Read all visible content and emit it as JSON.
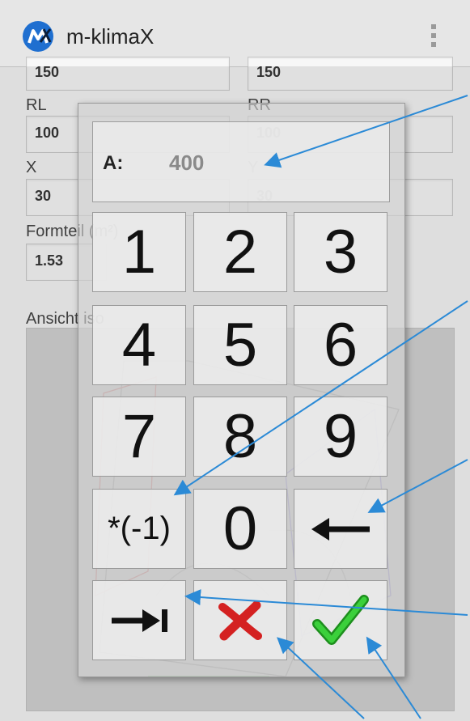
{
  "app": {
    "title": "m-klimaX"
  },
  "form": {
    "top_left_value": "150",
    "top_right_value": "150",
    "rl_label": "RL",
    "rl_value": "100",
    "rr_label": "RR",
    "rr_value": "100",
    "x_label": "X",
    "x_value": "30",
    "y_label": "Y",
    "y_value": "30",
    "formteil_label": "Formteil (m²)",
    "formteil_value": "1.53",
    "view_label": "Ansicht iso"
  },
  "keypad": {
    "display_label": "A:",
    "display_value": "400",
    "keys": [
      "1",
      "2",
      "3",
      "4",
      "5",
      "6",
      "7",
      "8",
      "9",
      "*(-1)",
      "0"
    ]
  },
  "icons": {
    "backspace": "left-arrow-icon",
    "tab": "tab-to-end-icon",
    "cancel": "red-x-icon",
    "confirm": "green-check-icon"
  },
  "colors": {
    "logo": "#1f6fd0",
    "cancel": "#d42121",
    "confirm": "#2fb62f",
    "annotation": "#2b8ad6"
  }
}
